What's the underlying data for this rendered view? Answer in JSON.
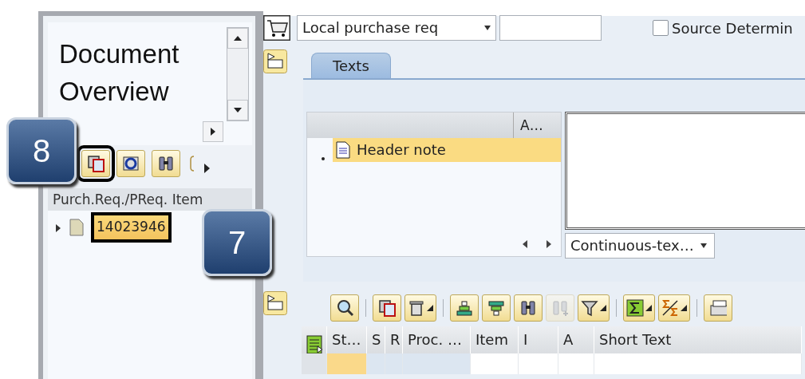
{
  "left_panel": {
    "title": "Document Overview",
    "toolbar": [
      {
        "kind": "copy",
        "highlighted": true
      },
      {
        "kind": "refresh",
        "highlighted": false
      },
      {
        "kind": "find",
        "highlighted": false
      },
      {
        "kind": "partial",
        "highlighted": false
      }
    ],
    "column_header": "Purch.Req./PReq. Item",
    "tree": [
      {
        "label": "14023946",
        "expanded": false,
        "highlighted": true
      }
    ]
  },
  "header": {
    "document_type": "Local purchase req",
    "source_determination": {
      "label": "Source Determin",
      "checked": false
    }
  },
  "tabs": [
    {
      "label": "Texts",
      "selected": true
    }
  ],
  "texts_panel": {
    "column_header": "A…",
    "items": [
      {
        "label": "Header note",
        "selected": true
      }
    ],
    "format": "Continuous-tex…"
  },
  "items_toolbar": [
    {
      "kind": "details",
      "disabled": false,
      "menu": false
    },
    {
      "kind": "sep"
    },
    {
      "kind": "copy",
      "disabled": false,
      "menu": false
    },
    {
      "kind": "delete",
      "disabled": false,
      "menu": true
    },
    {
      "kind": "sep"
    },
    {
      "kind": "sort_up",
      "disabled": false,
      "menu": false
    },
    {
      "kind": "sort_down",
      "disabled": false,
      "menu": false
    },
    {
      "kind": "find",
      "disabled": false,
      "menu": false
    },
    {
      "kind": "find_next",
      "disabled": true,
      "menu": false
    },
    {
      "kind": "filter",
      "disabled": false,
      "menu": true
    },
    {
      "kind": "sep"
    },
    {
      "kind": "sum",
      "disabled": false,
      "menu": true
    },
    {
      "kind": "subtotal",
      "disabled": false,
      "menu": true
    },
    {
      "kind": "sep"
    },
    {
      "kind": "print",
      "disabled": false,
      "menu": false
    }
  ],
  "items_table": {
    "columns": [
      "St…",
      "S",
      "R",
      "Proc. …",
      "Item",
      "I",
      "A",
      "Short Text"
    ]
  },
  "callouts": [
    {
      "label": "8"
    },
    {
      "label": "7"
    }
  ]
}
